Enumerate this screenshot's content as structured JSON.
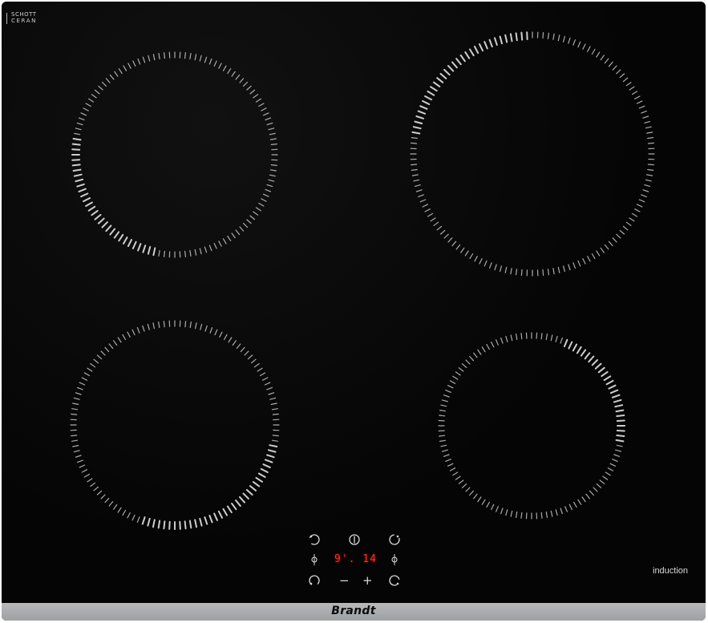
{
  "hob": {
    "glass_brand": {
      "line1": "SCHOTT",
      "line2": "CERAN"
    },
    "induction_label": "induction",
    "brand_name": "Brandt",
    "display_text": "9'. 14",
    "minus_label": "−",
    "plus_label": "+",
    "colors": {
      "glass": "#050505",
      "marks": "#d9d9d9",
      "display": "#ff2a1a",
      "frame": "#aeb0b2"
    },
    "icons": [
      "power-icon",
      "zone-selector-icon",
      "timer-icon"
    ]
  }
}
